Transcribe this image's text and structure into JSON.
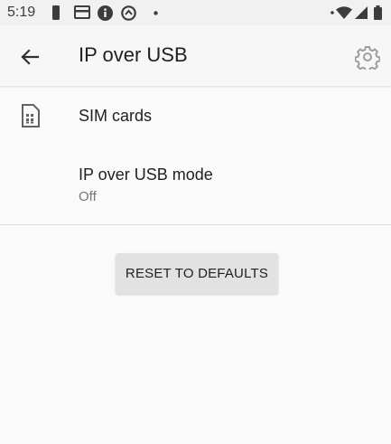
{
  "status_bar": {
    "time": "5:19"
  },
  "app_bar": {
    "title": "IP over USB"
  },
  "preferences": [
    {
      "title": "SIM cards"
    },
    {
      "title": "IP over USB mode",
      "summary": "Off"
    }
  ],
  "reset_button": {
    "label": "RESET TO DEFAULTS"
  },
  "icons": [
    "back-arrow-icon",
    "gear-icon",
    "sim-card-icon",
    "battery-icon",
    "wifi-icon",
    "cellular-signal-icon"
  ]
}
